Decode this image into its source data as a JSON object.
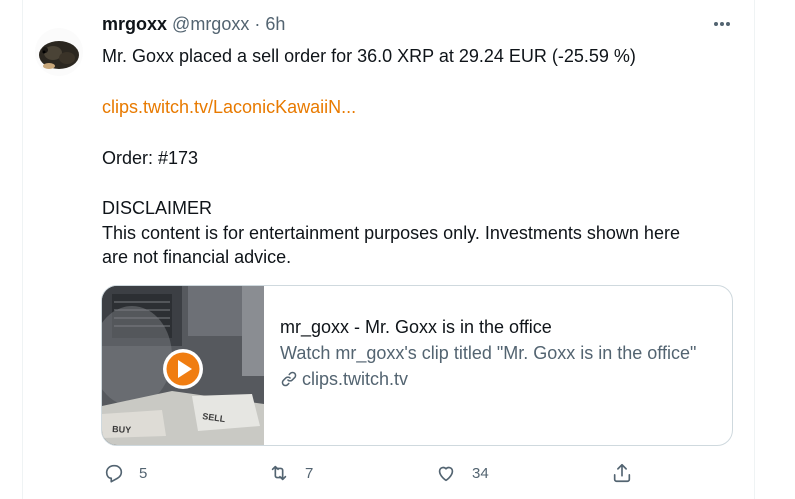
{
  "tweet": {
    "display_name": "mrgoxx",
    "handle": "@mrgoxx",
    "separator": "·",
    "time": "6h",
    "more_icon": "more-horizontal-icon",
    "lines": {
      "order_line": "Mr. Goxx placed a sell order for 36.0 XRP at 29.24 EUR (-25.59 %)",
      "link": "clips.twitch.tv/LaconicKawaiiN...",
      "order_number": "Order: #173",
      "disclaimer_title": "DISCLAIMER",
      "disclaimer_line1": "This content is for entertainment purposes only. Investments shown here",
      "disclaimer_line2": "are not financial advice."
    },
    "card": {
      "title": "mr_goxx - Mr. Goxx is in the office",
      "description": "Watch mr_goxx's clip titled \"Mr. Goxx is in the office\"",
      "domain": "clips.twitch.tv",
      "thumb_labels": {
        "sell": "SELL",
        "buy": "BUY"
      },
      "play_color": "#f07d11"
    },
    "actions": {
      "reply_count": "5",
      "retweet_count": "7",
      "like_count": "34"
    },
    "colors": {
      "link": "#e87a00",
      "muted": "#536471",
      "text": "#0f1419",
      "border": "#cfd9de"
    }
  }
}
